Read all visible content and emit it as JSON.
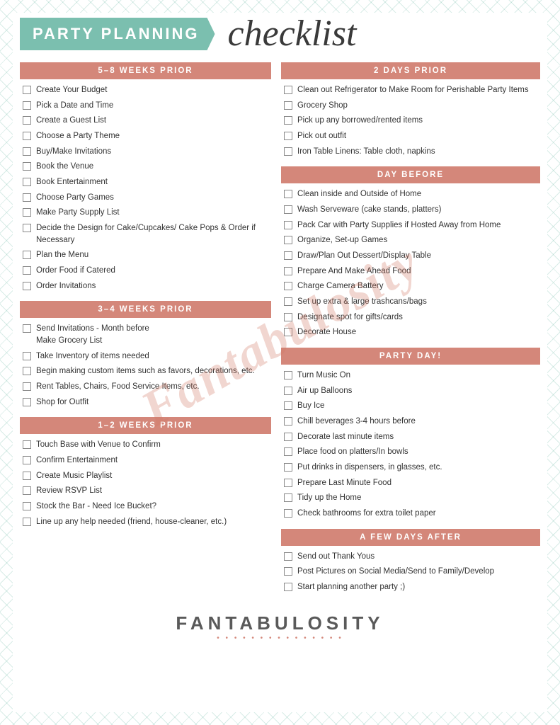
{
  "header": {
    "banner_text": "PARTY PLANNING",
    "checklist_text": "checklist"
  },
  "footer": {
    "brand": "FANTABULOSITY",
    "dots": "• • • • • • • • • • • • • • •"
  },
  "watermark": "Fantabulosity",
  "sections": {
    "weeks_5_8": {
      "title": "5–8 WEEKS PRIOR",
      "items": [
        "Create Your Budget",
        "Pick a Date and Time",
        "Create a Guest List",
        "Choose a Party Theme",
        "Buy/Make Invitations",
        "Book the Venue",
        "Book Entertainment",
        "Choose Party Games",
        "Make Party Supply List",
        "Decide the Design for Cake/Cupcakes/ Cake Pops & Order if Necessary",
        "Plan the Menu",
        "Order Food if Catered",
        "Order Invitations"
      ]
    },
    "weeks_3_4": {
      "title": "3–4 WEEKS PRIOR",
      "items": [
        "Send Invitations - Month before Make Grocery List",
        "Take Inventory of items needed",
        "Begin making custom items such as favors, decorations, etc.",
        "Rent Tables, Chairs, Food Service Items, etc.",
        "Shop for Outfit"
      ]
    },
    "weeks_1_2": {
      "title": "1–2 WEEKS PRIOR",
      "items": [
        "Touch Base with Venue to Confirm",
        "Confirm Entertainment",
        "Create Music Playlist",
        "Review RSVP List",
        "Stock the Bar - Need Ice Bucket?",
        "Line up any help needed (friend, house-cleaner, etc.)"
      ]
    },
    "days_2": {
      "title": "2 DAYS PRIOR",
      "items": [
        "Clean out Refrigerator to Make Room for Perishable Party Items",
        "Grocery Shop",
        "Pick up any borrowed/rented items",
        "Pick out outfit",
        "Iron Table Linens: Table cloth, napkins"
      ]
    },
    "day_before": {
      "title": "DAY BEFORE",
      "items": [
        "Clean inside and Outside of Home",
        "Wash Serveware (cake stands, platters)",
        "Pack Car with Party Supplies if Hosted Away from Home",
        "Organize, Set-up Games",
        "Draw/Plan Out Dessert/Display Table",
        "Prepare And Make Ahead Food",
        "Charge Camera Battery",
        "Set up extra & large trashcans/bags",
        "Designate spot for gifts/cards",
        "Decorate House"
      ]
    },
    "party_day": {
      "title": "PARTY DAY!",
      "items": [
        "Turn Music On",
        "Air up Balloons",
        "Buy Ice",
        "Chill beverages 3-4 hours before",
        " Decorate last minute items",
        "Place food on platters/In bowls",
        "Put drinks in dispensers, in glasses, etc.",
        "Prepare Last Minute Food",
        "Tidy up the Home",
        "Check bathrooms for extra toilet paper"
      ]
    },
    "few_days_after": {
      "title": "A FEW DAYS AFTER",
      "items": [
        "Send out Thank Yous",
        "Post Pictures on Social Media/Send to Family/Develop",
        "Start planning another party ;)"
      ]
    }
  }
}
